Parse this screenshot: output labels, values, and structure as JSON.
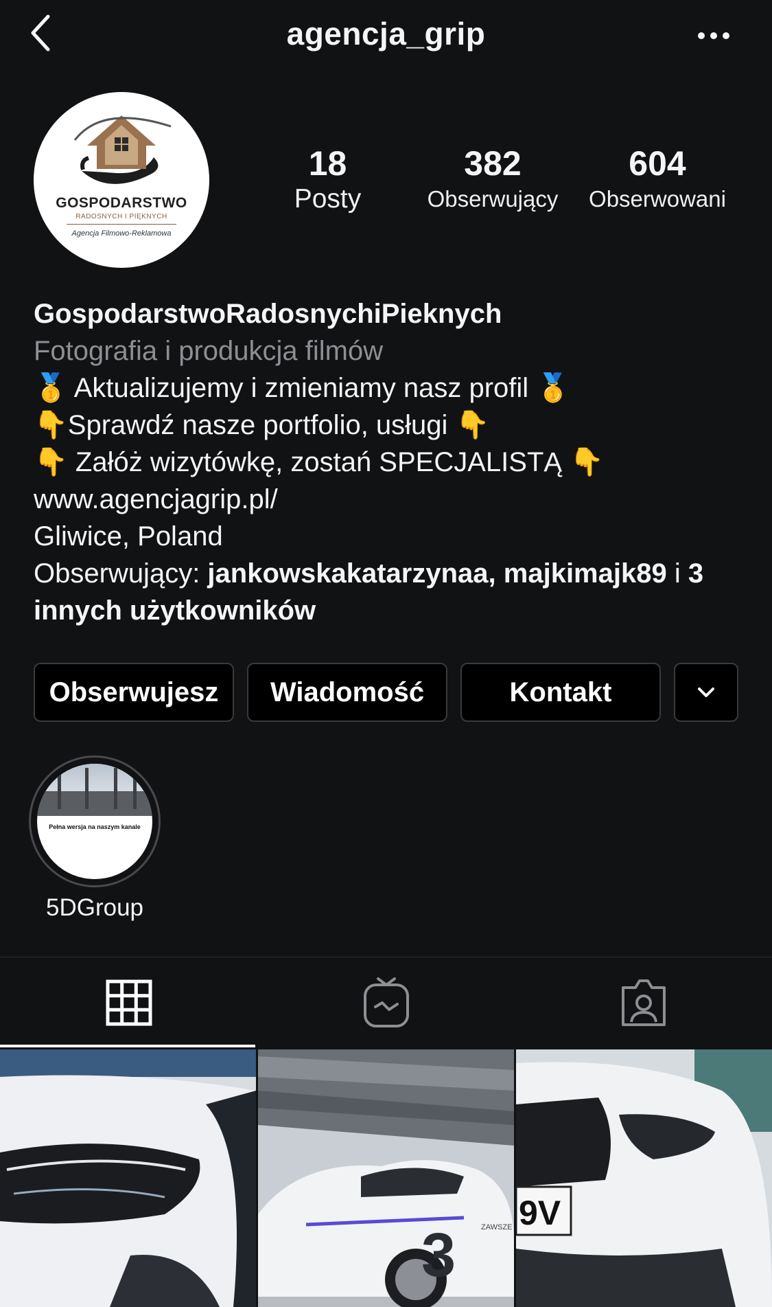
{
  "header": {
    "username": "agencja_grip",
    "back_icon": "chevron-left-icon",
    "more_icon": "more-horizontal-icon"
  },
  "avatar": {
    "title": "GOSPODARSTWO",
    "subtitle": "RADOSNYCH I PIĘKNYCH",
    "tagline": "Agencja Filmowo-Reklamowa"
  },
  "stats": {
    "posts": {
      "value": "18",
      "label": "Posty"
    },
    "followers": {
      "value": "382",
      "label": "Obserwujący"
    },
    "following": {
      "value": "604",
      "label": "Obserwowani"
    }
  },
  "bio": {
    "name": "GospodarstwoRadosnychiPieknych",
    "category": "Fotografia i produkcja filmów",
    "lines": [
      "🥇 Aktualizujemy i zmieniamy nasz profil 🥇",
      "👇Sprawdź nasze portfolio, usługi  👇",
      "👇 Załóż wizytówkę, zostań SPECJALISTĄ 👇"
    ],
    "website": "www.agencjagrip.pl/",
    "location": "Gliwice, Poland",
    "followed_by_prefix": "Obserwujący: ",
    "followed_by_users": "jankowskakatarzynaa, majkimajk89",
    "followed_by_joiner": " i ",
    "followed_by_others": "3 innych użytkowników"
  },
  "actions": {
    "following_label": "Obserwujesz",
    "message_label": "Wiadomość",
    "contact_label": "Kontakt",
    "dropdown_icon": "chevron-down-icon"
  },
  "highlights": [
    {
      "label": "5DGroup",
      "cover_text": "Pełna wersja na naszym kanale"
    }
  ],
  "tabs": [
    {
      "icon": "grid-icon",
      "active": true
    },
    {
      "icon": "igtv-icon",
      "active": false
    },
    {
      "icon": "tagged-icon",
      "active": false
    }
  ],
  "photo_texts": {
    "plate": "9V",
    "wrap_number": "3",
    "wrap_text": "ZAWSZE NA"
  },
  "colors": {
    "background": "#111214",
    "button_background": "#000000",
    "button_border": "#3a3a3c",
    "secondary_text": "#8e8e93",
    "text": "#f5f5f5"
  }
}
